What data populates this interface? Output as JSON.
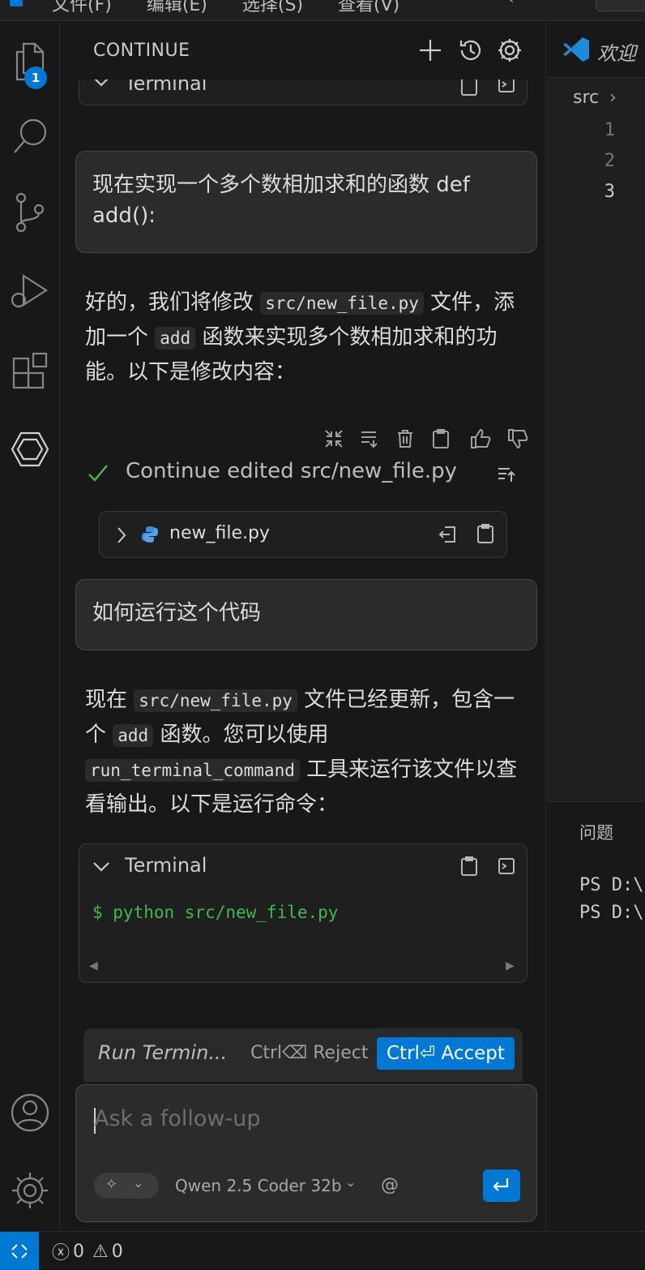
{
  "titlebar": {
    "menu": [
      "文件(F)",
      "编辑(E)",
      "选择(S)",
      "查看(V)"
    ]
  },
  "activity": {
    "explorer_badge": "1"
  },
  "sidebar": {
    "title": "CONTINUE",
    "top_terminal_label": "Terminal",
    "messages": {
      "user1": "现在实现一个多个数相加求和的函数 def add():",
      "assistant1": {
        "p1": "好的，我们将修改 ",
        "code1": "src/new_file.py",
        "p2": " 文件，添加一个 ",
        "code2": "add",
        "p3": " 函数来实现多个数相加求和的功能。以下是修改内容："
      },
      "edited_status": "Continue edited src/new_file.py",
      "file_name": "new_file.py",
      "user2": "如何运行这个代码",
      "assistant2": {
        "p1": "现在 ",
        "code1": "src/new_file.py",
        "p2": " 文件已经更新，包含一个 ",
        "code2": "add",
        "p3": " 函数。您可以使用 ",
        "code3": "run_terminal_command",
        "p4": " 工具来运行该文件以查看输出。以下是运行命令："
      },
      "terminal_label": "Terminal",
      "terminal_command": "$ python src/new_file.py"
    },
    "action_bar": {
      "run_label": "Run Termin...",
      "reject_label": "Ctrl⌫ Reject",
      "accept_label": "Ctrl⏎ Accept"
    },
    "input": {
      "placeholder": "Ask a follow-up",
      "model": "Qwen 2.5 Coder 32b",
      "at_symbol": "@"
    }
  },
  "editor": {
    "tab_title": "欢迎",
    "breadcrumb": "src",
    "line_numbers": [
      "1",
      "2",
      "3"
    ]
  },
  "panel": {
    "tab": "问题",
    "lines": [
      "PS D:\\",
      "PS D:\\"
    ]
  },
  "statusbar": {
    "errors": "0",
    "warnings": "0"
  },
  "colors": {
    "accent": "#0078d4",
    "terminal_green": "#3fb950",
    "check_green": "#3fb950"
  }
}
